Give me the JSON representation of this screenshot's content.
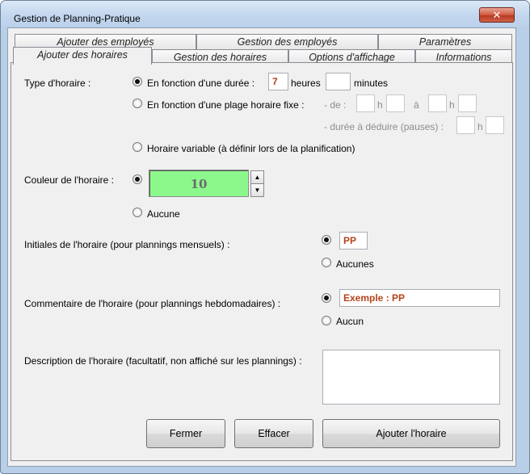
{
  "window": {
    "title": "Gestion de Planning-Pratique",
    "close_glyph": "✕"
  },
  "tabs": {
    "back_row": [
      "Ajouter des employés",
      "Gestion des employés",
      "Paramètres"
    ],
    "front_row": [
      "Ajouter des horaires",
      "Gestion des horaires",
      "Options d'affichage",
      "Informations"
    ],
    "active": "Ajouter des horaires"
  },
  "type": {
    "label": "Type d'horaire :",
    "duration_label": "En fonction d'une durée :",
    "hours_value": "7",
    "hours_unit": "heures",
    "minutes_value": "",
    "minutes_unit": "minutes",
    "range_label": "En fonction d'une plage horaire fixe :",
    "from_label": "- de :",
    "h": "h",
    "to_label": "à",
    "deduct_label": "- durée à déduire (pauses) :",
    "variable_label": "Horaire variable (à définir lors de la planification)"
  },
  "color": {
    "label": "Couleur de l'horaire :",
    "value": "10",
    "swatch": "#8cf88c",
    "none_label": "Aucune",
    "up_glyph": "▲",
    "down_glyph": "▼"
  },
  "initials": {
    "label": "Initiales de l'horaire (pour plannings mensuels) :",
    "value": "PP",
    "none_label": "Aucunes"
  },
  "comment": {
    "label": "Commentaire de l'horaire (pour plannings hebdomadaires) :",
    "value": "Exemple : PP",
    "none_label": "Aucun"
  },
  "description": {
    "label": "Description de l'horaire (facultatif, non affiché sur les plannings) :",
    "value": ""
  },
  "buttons": {
    "close": "Fermer",
    "clear": "Effacer",
    "add": "Ajouter l'horaire"
  }
}
